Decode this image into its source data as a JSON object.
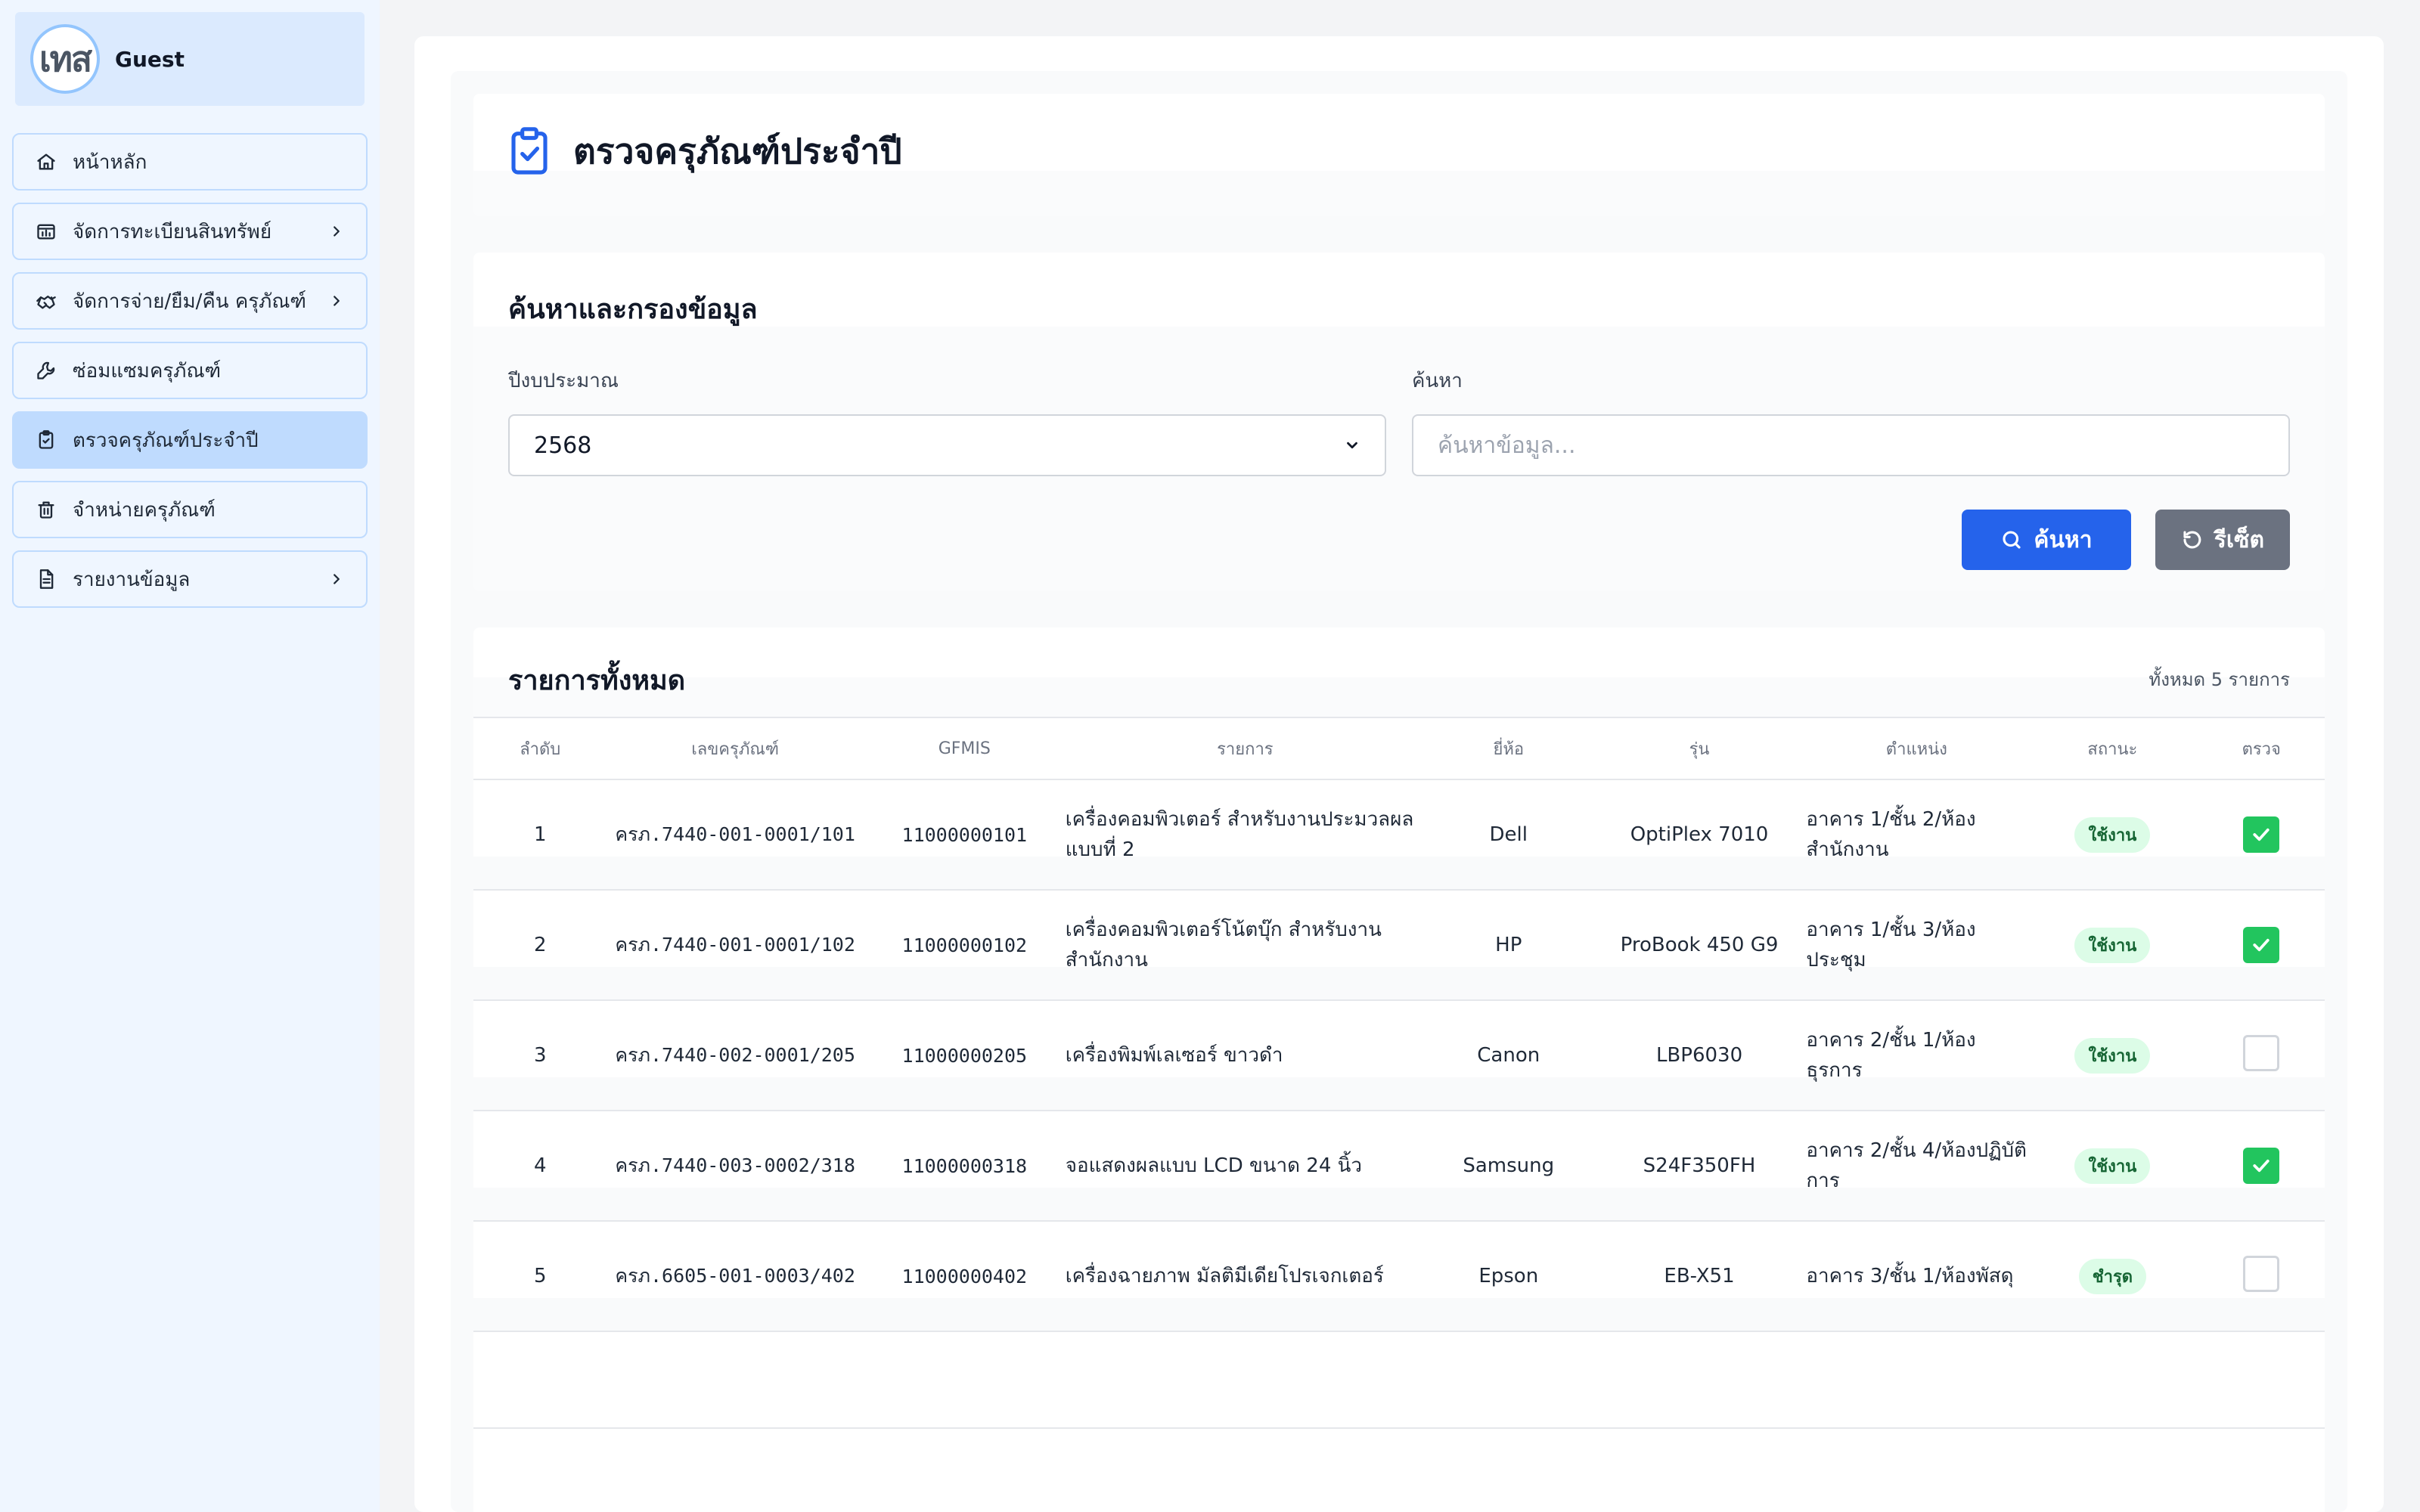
{
  "user": {
    "avatar_text": "เทส",
    "name": "Guest"
  },
  "sidebar": {
    "items": [
      {
        "label": "หน้าหลัก",
        "icon": "home-icon",
        "chevron": false,
        "active": false
      },
      {
        "label": "จัดการทะเบียนสินทรัพย์",
        "icon": "folder-chart-icon",
        "chevron": true,
        "active": false
      },
      {
        "label": "จัดการจ่าย/ยืม/คืน ครุภัณฑ์",
        "icon": "handshake-icon",
        "chevron": true,
        "active": false
      },
      {
        "label": "ซ่อมแซมครุภัณฑ์",
        "icon": "wrench-icon",
        "chevron": false,
        "active": false
      },
      {
        "label": "ตรวจครุภัณฑ์ประจำปี",
        "icon": "clipboard-check-icon",
        "chevron": false,
        "active": true
      },
      {
        "label": "จำหน่ายครุภัณฑ์",
        "icon": "trash-icon",
        "chevron": false,
        "active": false
      },
      {
        "label": "รายงานข้อมูล",
        "icon": "document-icon",
        "chevron": true,
        "active": false
      }
    ]
  },
  "page": {
    "title": "ตรวจครุภัณฑ์ประจำปี"
  },
  "filter": {
    "title": "ค้นหาและกรองข้อมูล",
    "year_label": "ปีงบประมาณ",
    "year_value": "2568",
    "search_label": "ค้นหา",
    "search_placeholder": "ค้นหาข้อมูล...",
    "search_button": "ค้นหา",
    "reset_button": "รีเซ็ต"
  },
  "list": {
    "title": "รายการทั้งหมด",
    "total": "ทั้งหมด 5 รายการ",
    "columns": [
      "ลำดับ",
      "เลขครุภัณฑ์",
      "GFMIS",
      "รายการ",
      "ยี่ห้อ",
      "รุ่น",
      "ตำแหน่ง",
      "สถานะ",
      "ตรวจ"
    ],
    "rows": [
      {
        "no": "1",
        "asset_no": "ครภ.7440-001-0001/101",
        "gfmis": "11000000101",
        "item": "เครื่องคอมพิวเตอร์ สำหรับงานประมวลผลแบบที่ 2",
        "brand": "Dell",
        "model": "OptiPlex 7010",
        "location": "อาคาร 1/ชั้น 2/ห้องสำนักงาน",
        "status": "ใช้งาน",
        "checked": true
      },
      {
        "no": "2",
        "asset_no": "ครภ.7440-001-0001/102",
        "gfmis": "11000000102",
        "item": "เครื่องคอมพิวเตอร์โน้ตบุ๊ก สำหรับงานสำนักงาน",
        "brand": "HP",
        "model": "ProBook 450 G9",
        "location": "อาคาร 1/ชั้น 3/ห้องประชุม",
        "status": "ใช้งาน",
        "checked": true
      },
      {
        "no": "3",
        "asset_no": "ครภ.7440-002-0001/205",
        "gfmis": "11000000205",
        "item": "เครื่องพิมพ์เลเซอร์ ขาวดำ",
        "brand": "Canon",
        "model": "LBP6030",
        "location": "อาคาร 2/ชั้น 1/ห้องธุรการ",
        "status": "ใช้งาน",
        "checked": false
      },
      {
        "no": "4",
        "asset_no": "ครภ.7440-003-0002/318",
        "gfmis": "11000000318",
        "item": "จอแสดงผลแบบ LCD ขนาด 24 นิ้ว",
        "brand": "Samsung",
        "model": "S24F350FH",
        "location": "อาคาร 2/ชั้น 4/ห้องปฏิบัติการ",
        "status": "ใช้งาน",
        "checked": true
      },
      {
        "no": "5",
        "asset_no": "ครภ.6605-001-0003/402",
        "gfmis": "11000000402",
        "item": "เครื่องฉายภาพ มัลติมีเดียโปรเจกเตอร์",
        "brand": "Epson",
        "model": "EB-X51",
        "location": "อาคาร 3/ชั้น 1/ห้องพัสดุ",
        "status": "ชำรุด",
        "checked": false
      }
    ]
  },
  "colors": {
    "primary": "#2563eb",
    "secondary": "#6b7280",
    "success": "#22c55e",
    "sidebar_bg": "#eff6ff",
    "active_bg": "#bfdbfe"
  }
}
